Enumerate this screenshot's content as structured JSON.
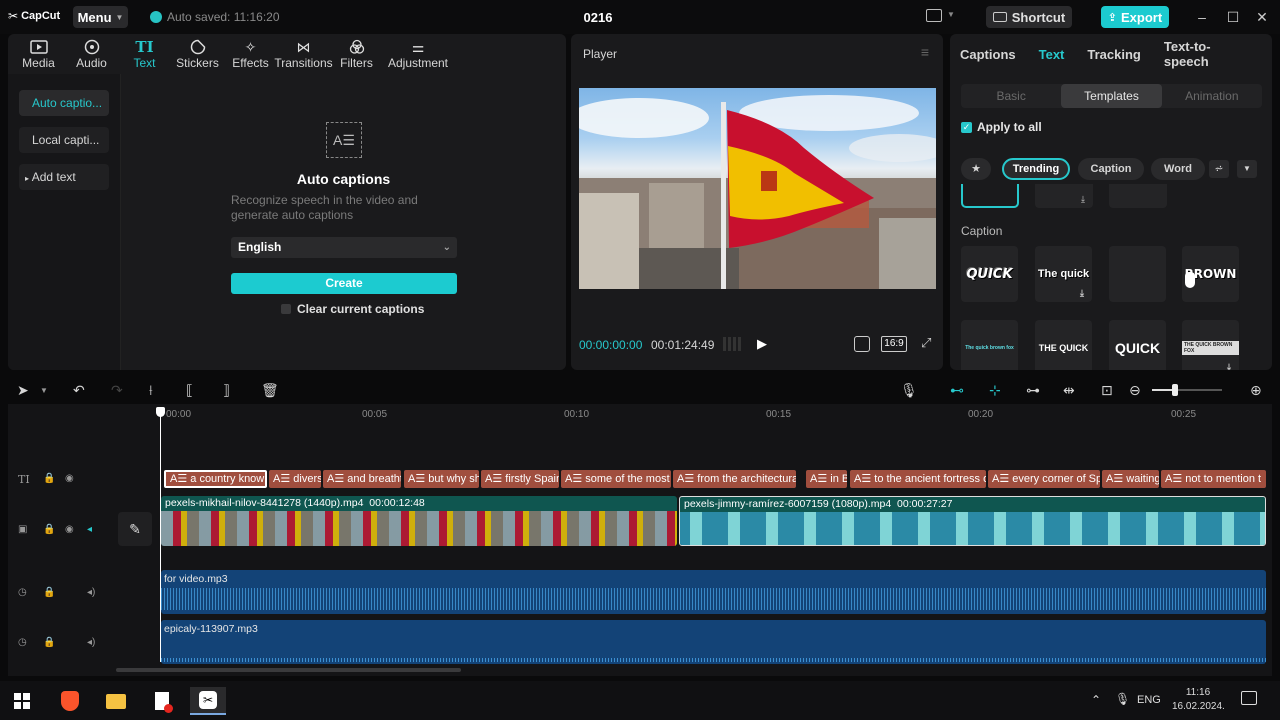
{
  "titlebar": {
    "logo": "CapCut",
    "menu_label": "Menu",
    "autosave_text": "Auto saved: 11:16:20",
    "project_title": "0216",
    "shortcut_label": "Shortcut",
    "export_label": "Export"
  },
  "media_toolbar": [
    {
      "label": "Media",
      "icon": "media-icon"
    },
    {
      "label": "Audio",
      "icon": "audio-icon"
    },
    {
      "label": "Text",
      "icon": "text-icon"
    },
    {
      "label": "Stickers",
      "icon": "stickers-icon"
    },
    {
      "label": "Effects",
      "icon": "effects-icon"
    },
    {
      "label": "Transitions",
      "icon": "transitions-icon"
    },
    {
      "label": "Filters",
      "icon": "filters-icon"
    },
    {
      "label": "Adjustment",
      "icon": "adjustment-icon"
    }
  ],
  "sidebar": {
    "items": [
      "Auto captio...",
      "Local capti...",
      "Add text"
    ]
  },
  "auto_captions": {
    "title": "Auto captions",
    "description": "Recognize speech in the video and generate auto captions",
    "language": "English",
    "create_label": "Create",
    "clear_label": "Clear current captions"
  },
  "player": {
    "label": "Player",
    "current_time": "00:00:00:00",
    "total_time": "00:01:24:49",
    "aspect_ratio": "16:9"
  },
  "inspector": {
    "tabs": [
      "Captions",
      "Text",
      "Tracking",
      "Text-to-speech"
    ],
    "sub_tabs": [
      "Basic",
      "Templates",
      "Animation"
    ],
    "apply_all_label": "Apply to all",
    "filter_chips": [
      "Trending",
      "Caption",
      "Word"
    ],
    "section_label": "Caption",
    "templates_row1": [
      "QUICK",
      "The quick",
      "",
      "BROWN"
    ],
    "templates_row2": [
      "The quick brown fox",
      "THE QUICK",
      "QUICK",
      "THE QUICK BROWN FOX"
    ]
  },
  "timeline": {
    "ruler": [
      "00:00",
      "00:05",
      "00:10",
      "00:15",
      "00:20",
      "00:25"
    ],
    "captions": [
      "a country know",
      "diverse",
      "and breathtaking",
      "but why sho",
      "firstly Spain",
      "some of the most",
      "from the architectural",
      "in B",
      "to the ancient fortress o",
      "every corner of Spa",
      "waiting",
      "not to mention t"
    ],
    "video_clips": [
      {
        "name": "pexels-mikhail-nilov-8441278 (1440p).mp4",
        "duration": "00:00:12:48"
      },
      {
        "name": "pexels-jimmy-ramírez-6007159 (1080p).mp4",
        "duration": "00:00:27:27"
      }
    ],
    "audio_clips": [
      "for video.mp3",
      "epicaly-113907.mp3"
    ]
  },
  "taskbar": {
    "language": "ENG",
    "time": "11:16",
    "date": "16.02.2024."
  },
  "colors": {
    "accent": "#1ccbd0",
    "caption_clip": "#a04e3e",
    "audio_clip": "#134377"
  }
}
